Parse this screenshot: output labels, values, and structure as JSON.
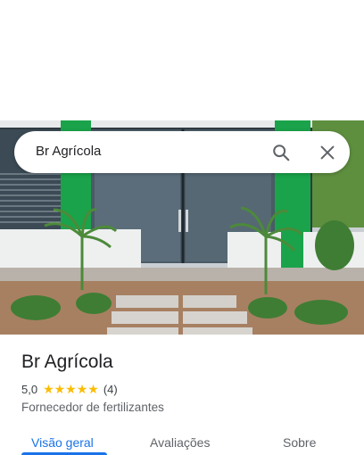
{
  "search": {
    "query": "Br Agrícola"
  },
  "place": {
    "name": "Br Agrícola",
    "rating": "5,0",
    "stars": "★★★★★",
    "review_count": "(4)",
    "category": "Fornecedor de fertilizantes"
  },
  "tabs": [
    {
      "label": "Visão geral",
      "active": true
    },
    {
      "label": "Avaliações",
      "active": false
    },
    {
      "label": "Sobre",
      "active": false
    }
  ],
  "colors": {
    "accent": "#1a73e8",
    "star": "#fbbc04",
    "brand_green": "#1aa34a"
  }
}
